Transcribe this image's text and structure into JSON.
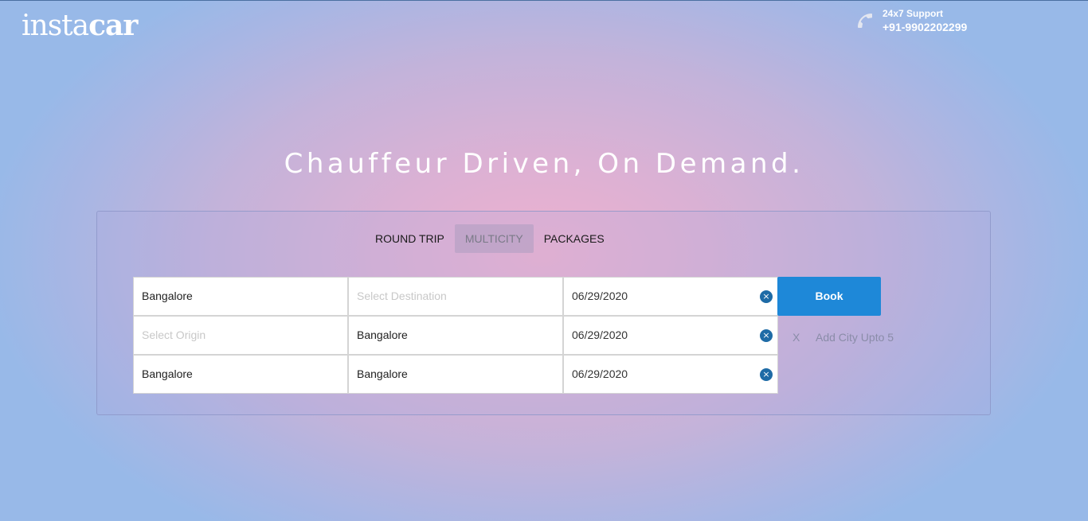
{
  "header": {
    "logo_light": "insta",
    "logo_bold": "car",
    "support_label": "24x7 Support",
    "support_number": "+91-9902202299",
    "support_icon": "phone-icon"
  },
  "hero": {
    "headline": "Chauffeur Driven, On Demand."
  },
  "tabs": [
    {
      "label": "ROUND TRIP",
      "active": false
    },
    {
      "label": "MULTICITY",
      "active": true
    },
    {
      "label": "PACKAGES",
      "active": false
    }
  ],
  "trips": [
    {
      "origin": "Bangalore",
      "origin_placeholder": "Select Origin",
      "destination": "",
      "destination_placeholder": "Select Destination",
      "date": "06/29/2020"
    },
    {
      "origin": "",
      "origin_placeholder": "Select Origin",
      "destination": "Bangalore",
      "destination_placeholder": "Select Destination",
      "date": "06/29/2020"
    },
    {
      "origin": "Bangalore",
      "origin_placeholder": "Select Origin",
      "destination": "Bangalore",
      "destination_placeholder": "Select Destination",
      "date": "06/29/2020"
    }
  ],
  "clear_icon_glyph": "×",
  "book_label": "Book",
  "add_city": {
    "remove_label": "X",
    "label": "Add City Upto 5"
  },
  "colors": {
    "accent": "#1e88d8",
    "clear_icon": "#1e6ba6"
  }
}
